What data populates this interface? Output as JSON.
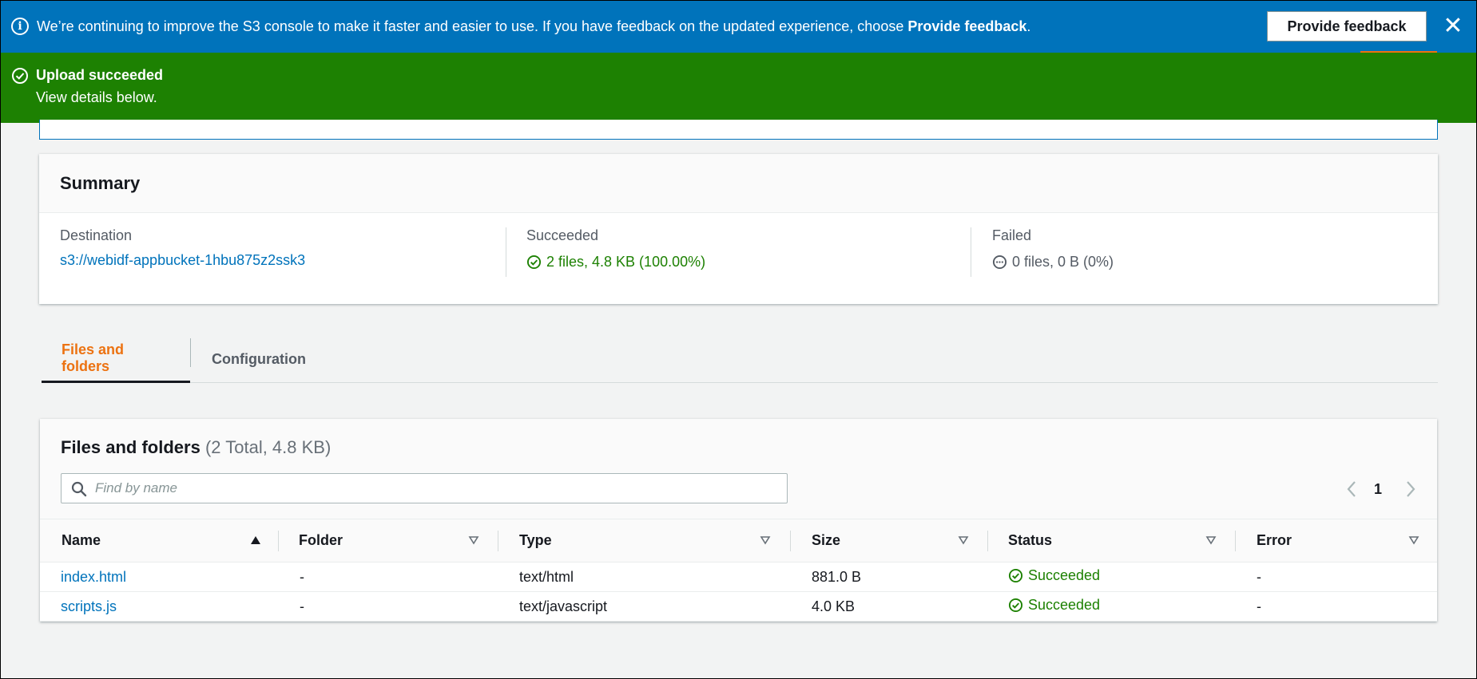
{
  "info_banner": {
    "text_prefix": "We’re continuing to improve the S3 console to make it faster and easier to use. If you have feedback on the updated experience, choose ",
    "text_bold": "Provide feedback",
    "text_suffix": ".",
    "button_label": "Provide feedback",
    "close_glyph": "✕"
  },
  "success_banner": {
    "title": "Upload succeeded",
    "subtitle": "View details below."
  },
  "summary": {
    "title": "Summary",
    "destination_label": "Destination",
    "destination_value": "s3://webidf-appbucket-1hbu875z2ssk3",
    "succeeded_label": "Succeeded",
    "succeeded_value": "2 files, 4.8 KB (100.00%)",
    "failed_label": "Failed",
    "failed_value": "0 files, 0 B (0%)"
  },
  "tabs": [
    {
      "label": "Files and folders",
      "active": true
    },
    {
      "label": "Configuration",
      "active": false
    }
  ],
  "files": {
    "title": "Files and folders",
    "count": "(2 Total, 4.8 KB)",
    "search_placeholder": "Find by name",
    "page": "1",
    "columns": [
      "Name",
      "Folder",
      "Type",
      "Size",
      "Status",
      "Error"
    ],
    "rows": [
      {
        "name": "index.html",
        "folder": "-",
        "type": "text/html",
        "size": "881.0 B",
        "status": "Succeeded",
        "error": "-"
      },
      {
        "name": "scripts.js",
        "folder": "-",
        "type": "text/javascript",
        "size": "4.0 KB",
        "status": "Succeeded",
        "error": "-"
      }
    ]
  },
  "colors": {
    "info_blue": "#0073bb",
    "success_green": "#1d8102",
    "accent_orange": "#ec7211"
  }
}
